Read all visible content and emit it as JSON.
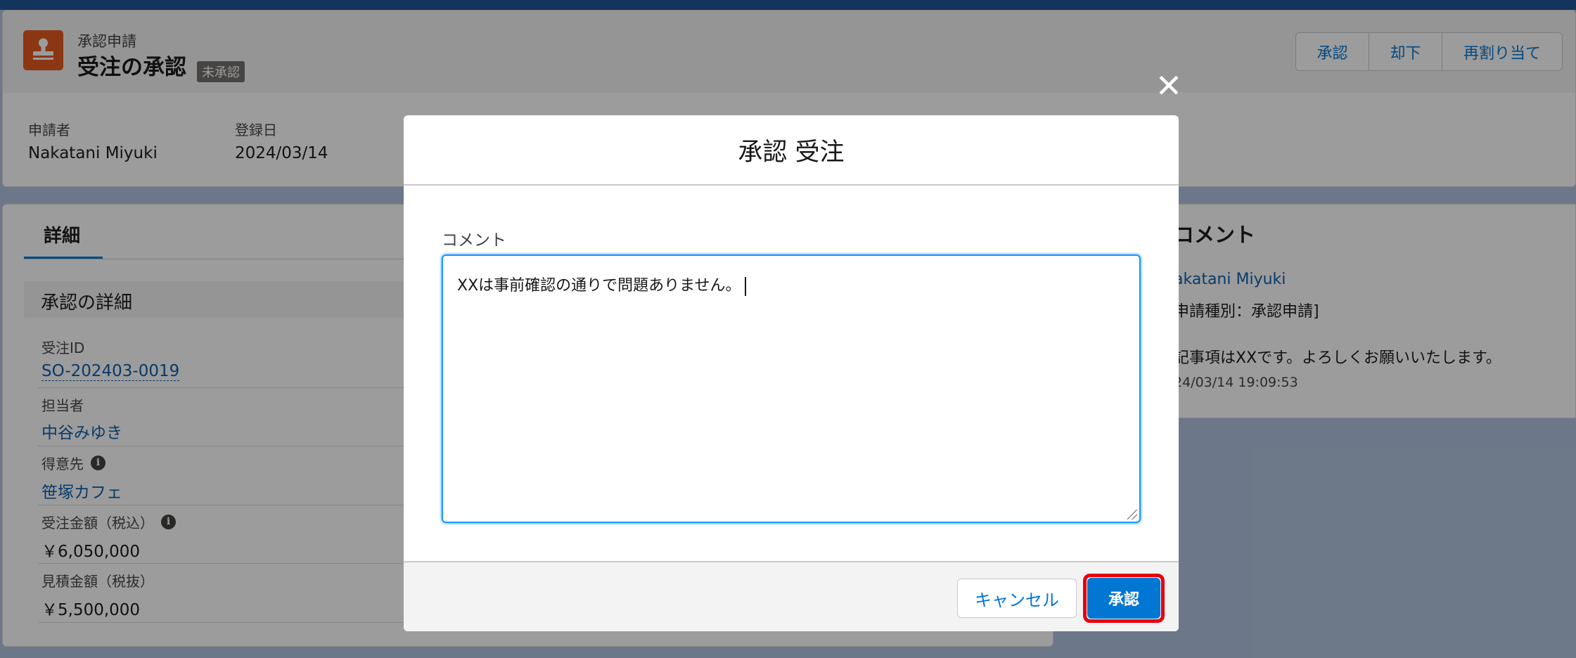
{
  "record": {
    "object_type": "承認申請",
    "title": "受注の承認",
    "status_badge": "未承認",
    "icon": "stamp-icon",
    "icon_color": "#e3581c",
    "actions": [
      "承認",
      "却下",
      "再割り当て"
    ]
  },
  "highlights": [
    {
      "label": "申請者",
      "value": "Nakatani Miyuki"
    },
    {
      "label": "登録日",
      "value": "2024/03/14"
    }
  ],
  "detail": {
    "tab_label": "詳細",
    "section_title": "承認の詳細",
    "fields": [
      {
        "label": "受注ID",
        "value": "SO-202403-0019",
        "link": true
      },
      {
        "label": "担当者",
        "value": "中谷みゆき",
        "link": true
      },
      {
        "label": "得意先",
        "value": "笹塚カフェ",
        "link": true,
        "info": true
      },
      {
        "label": "受注金額（税込）",
        "value": "￥6,050,000",
        "link": false,
        "info": true
      },
      {
        "label": "見積金額（税抜）",
        "value": "￥5,500,000",
        "link": false
      }
    ]
  },
  "comment_panel": {
    "title": "コメント",
    "author": "akatani Miyuki",
    "type": "申請種別：承認申請]",
    "body": "記事項はXXです。よろしくお願いいたします。",
    "timestamp": "24/03/14 19:09:53"
  },
  "modal": {
    "title": "承認 受注",
    "close_icon": "close-icon",
    "comment_label": "コメント",
    "comment_value": "XXは事前確認の通りで問題ありません。",
    "cancel_label": "キャンセル",
    "approve_label": "承認",
    "accent_color": "#0176d3",
    "highlight_color": "#e8000b"
  }
}
